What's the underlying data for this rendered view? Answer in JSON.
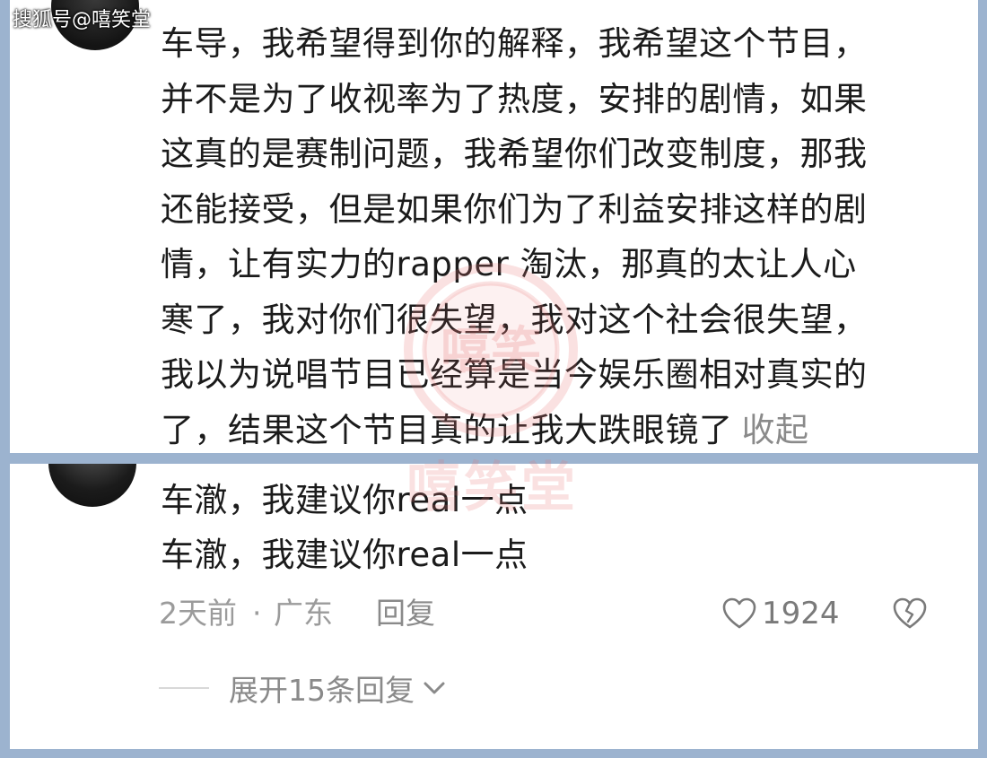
{
  "watermark": {
    "text": "搜狐号@嘻笑堂",
    "stamp_text": "嘻笑堂",
    "stamp_mark": "嘻笑"
  },
  "comment": {
    "lines": [
      "车导，我希望得到你的解释，我希望这个节目，",
      "并不是为了收视率为了热度，安排的剧情，如果",
      "这真的是赛制问题，我希望你们改变制度，那我",
      "还能接受，但是如果你们为了利益安排这样的剧",
      "情，让有实力的rapper 淘汰，那真的太让人心",
      "寒了，我对你们很失望，我对这个社会很失望，",
      "我以为说唱节目已经算是当今娱乐圈相对真实的",
      "了，结果这个节目真的让我大跌眼镜了"
    ],
    "collapse_label": "收起"
  },
  "reply": {
    "lines": [
      "车澈，我建议你real一点",
      "车澈，我建议你real一点"
    ],
    "time": "2天前",
    "dot": "·",
    "location": "广东",
    "reply_label": "回复",
    "like_count": "1924",
    "expand_label": "展开15条回复"
  },
  "icons": {
    "like": "heart-outline-icon",
    "dislike": "broken-heart-icon",
    "expand": "chevron-down-icon"
  },
  "colors": {
    "background": "#9cb3cf",
    "text": "#1b1b1b",
    "muted": "#9b9b9b",
    "stamp": "#e87878"
  }
}
